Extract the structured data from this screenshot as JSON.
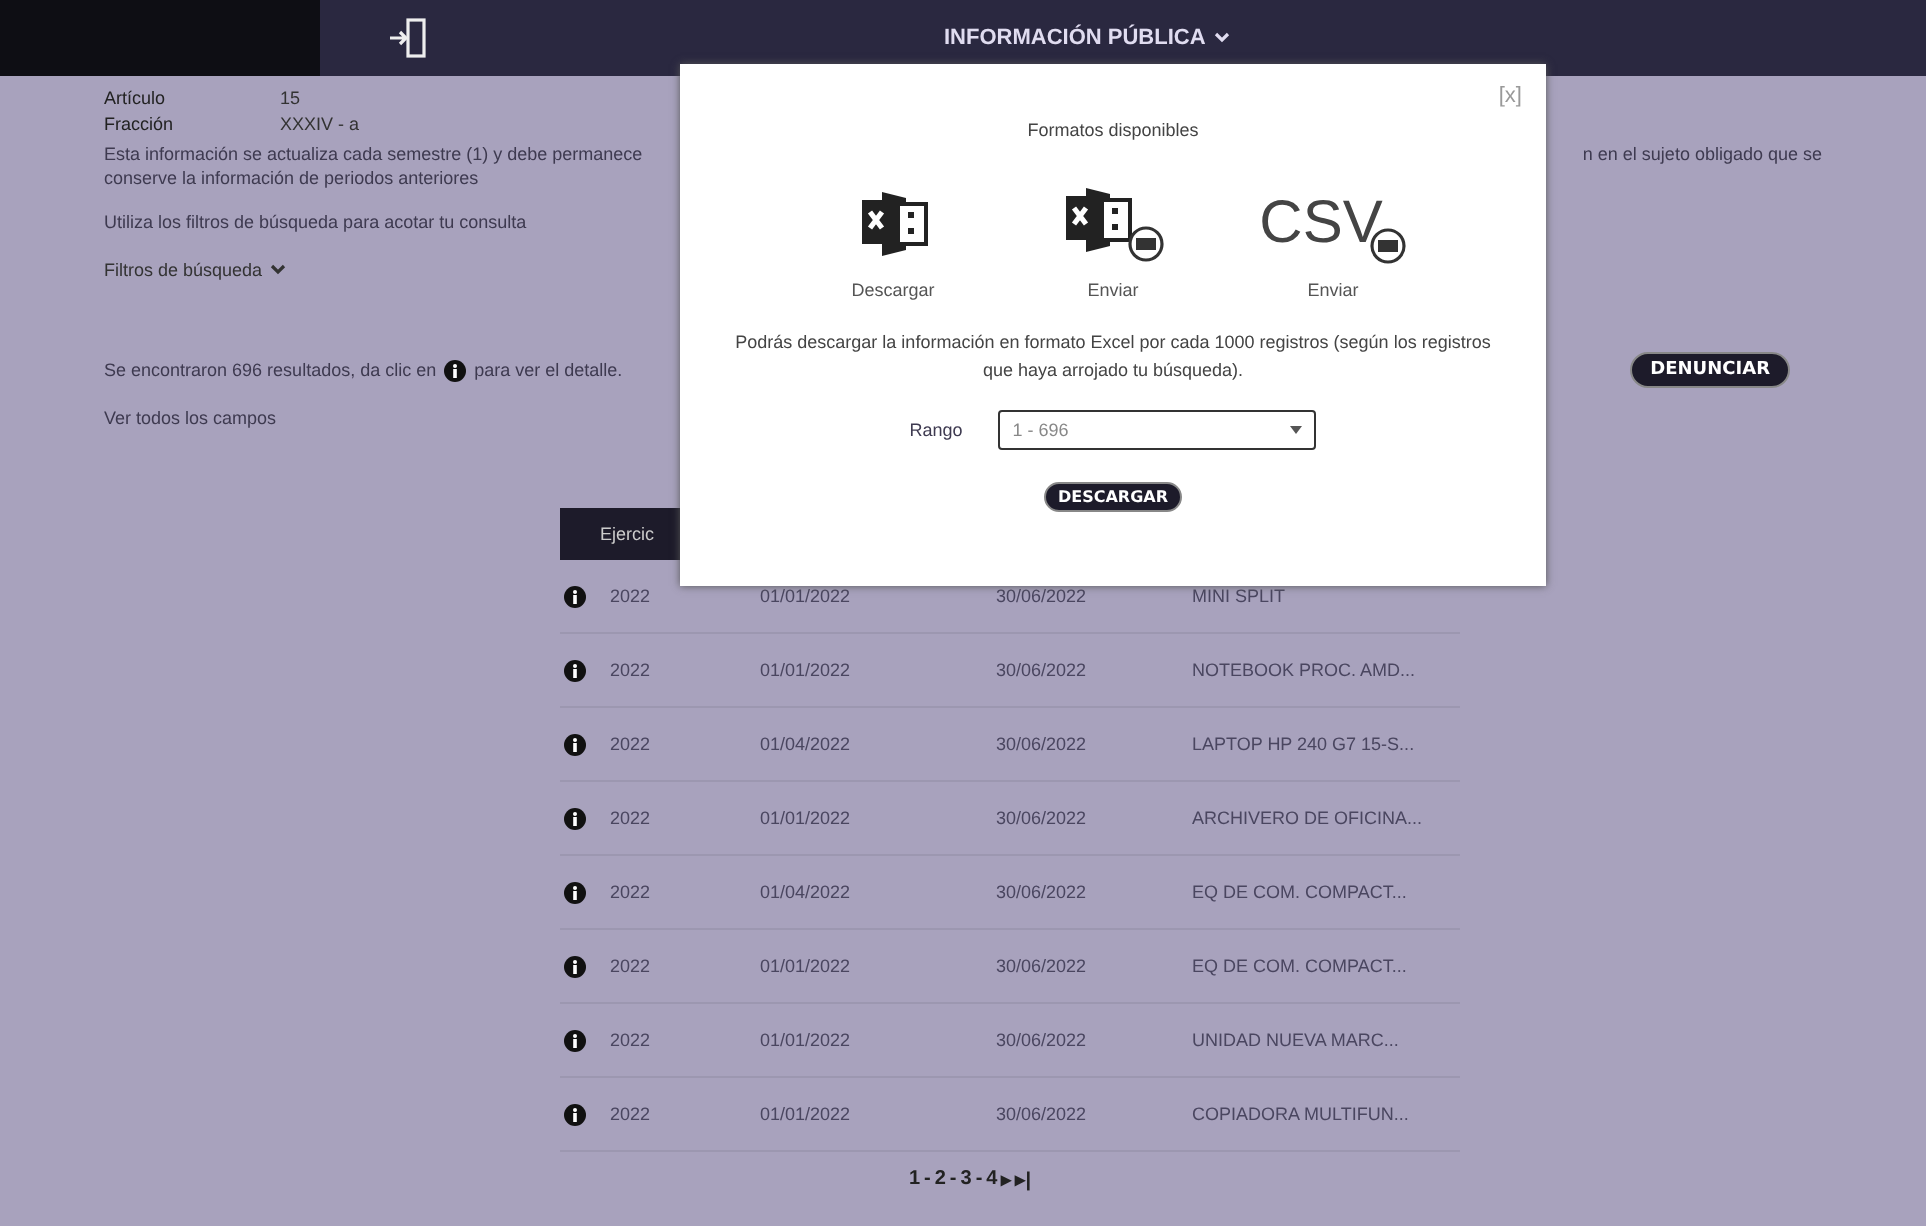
{
  "header": {
    "title": "INFORMACIÓN PÚBLICA"
  },
  "fields": [
    {
      "label": "Artículo",
      "value": "15"
    },
    {
      "label": "Fracción",
      "value": "XXXIV - a"
    }
  ],
  "notice": {
    "line_1": "Esta información se actualiza cada semestre (1) y debe permanece",
    "line_2": "conserve la información de periodos anteriores",
    "fragment": "n en el sujeto obligado que se"
  },
  "hint": "Utiliza los filtros de búsqueda para acotar tu consulta",
  "filters_toggle": "Filtros de búsqueda",
  "results": {
    "before": "Se encontraron 696 resultados, da clic en",
    "after": "para ver el detalle."
  },
  "all_fields_link": "Ver todos los campos",
  "report_button": "DENUNCIAR",
  "table": {
    "columns": [
      "Ejercic"
    ],
    "rows": [
      {
        "cells": [
          "2022",
          "01/01/2022",
          "30/06/2022",
          "MINI SPLIT"
        ]
      },
      {
        "cells": [
          "2022",
          "01/01/2022",
          "30/06/2022",
          "NOTEBOOK PROC. AMD..."
        ]
      },
      {
        "cells": [
          "2022",
          "01/04/2022",
          "30/06/2022",
          "LAPTOP HP 240 G7 15-S..."
        ]
      },
      {
        "cells": [
          "2022",
          "01/01/2022",
          "30/06/2022",
          "ARCHIVERO DE OFICINA..."
        ]
      },
      {
        "cells": [
          "2022",
          "01/04/2022",
          "30/06/2022",
          "EQ DE COM. COMPACT..."
        ]
      },
      {
        "cells": [
          "2022",
          "01/01/2022",
          "30/06/2022",
          "EQ DE COM. COMPACT..."
        ]
      },
      {
        "cells": [
          "2022",
          "01/01/2022",
          "30/06/2022",
          "UNIDAD NUEVA MARC..."
        ]
      },
      {
        "cells": [
          "2022",
          "01/01/2022",
          "30/06/2022",
          "COPIADORA MULTIFUN..."
        ]
      }
    ]
  },
  "pagination": {
    "pages": [
      "1",
      "2",
      "3",
      "4"
    ],
    "separator": "-",
    "next": "▸",
    "last": "▸|"
  },
  "modal": {
    "close": "[x]",
    "title": "Formatos disponibles",
    "formats": [
      {
        "kind": "excel",
        "label": "Descargar"
      },
      {
        "kind": "excel-mail",
        "label": "Enviar"
      },
      {
        "kind": "csv-mail",
        "label": "Enviar",
        "badge": "CSV"
      }
    ],
    "note": "Podrás descargar la información en formato Excel por cada 1000 registros (según los registros que haya arrojado tu búsqueda).",
    "range_label": "Rango",
    "range_value": "1 - 696",
    "button": "DESCARGAR"
  }
}
